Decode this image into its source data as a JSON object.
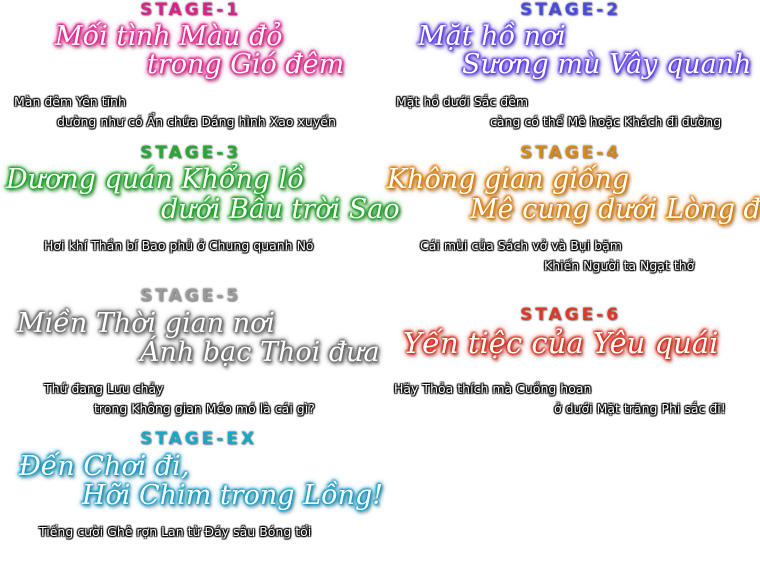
{
  "stages": [
    {
      "tag": "STAGE-1",
      "title_lines": [
        "Mối tình Màu đỏ",
        "trong Gió đêm"
      ],
      "desc_lines": [
        "Màn đêm Yên tĩnh",
        "dường như có Ẩn chứa Dáng hình Xao xuyến"
      ],
      "tag_color": "#e0208a",
      "glow_color": "#e0208a"
    },
    {
      "tag": "STAGE-2",
      "title_lines": [
        "Mặt hồ nơi",
        "Sương mù Vây quanh"
      ],
      "desc_lines": [
        "Mặt hồ dưới Sắc đêm",
        "càng có thể Mê hoặc Khách đi đường"
      ],
      "tag_color": "#4a4ae0",
      "glow_color": "#5a3ae8"
    },
    {
      "tag": "STAGE-3",
      "title_lines": [
        "Dương quán Khổng lồ",
        "dưới Bầu trời Sao"
      ],
      "desc_lines": [
        "Hơi khí Thần bí Bao phủ ở Chung quanh Nó"
      ],
      "tag_color": "#22aa33",
      "glow_color": "#18a020"
    },
    {
      "tag": "STAGE-4",
      "title_lines": [
        "Không gian giống",
        "Mê cung dưới Lòng đất"
      ],
      "desc_lines": [
        "Cái mùi của Sách vở và Bụi bặm",
        "Khiến Người ta Ngạt thở"
      ],
      "tag_color": "#d88a10",
      "glow_color": "#d87a08"
    },
    {
      "tag": "STAGE-5",
      "title_lines": [
        "Miền Thời gian nơi",
        "Ánh bạc Thoi đưa"
      ],
      "desc_lines": [
        "Thứ đang Lưu chảy",
        "trong Không gian Méo mó là cái gì?"
      ],
      "tag_color": "#9a9a9a",
      "glow_color": "#6a6a6a"
    },
    {
      "tag": "STAGE-6",
      "title_lines": [
        "Yến tiệc của Yêu quái"
      ],
      "desc_lines": [
        "Hãy Thỏa thích mà Cuồng hoan",
        "ở dưới Mặt trăng Phi sắc đi!"
      ],
      "tag_color": "#e03828",
      "glow_color": "#d82818"
    },
    {
      "tag": "STAGE-EX",
      "title_lines": [
        "Đến Chơi đi,",
        "Hỡi Chim trong Lồng!"
      ],
      "desc_lines": [
        "Tiếng cười Ghê rợn Lan từ Đáy sâu Bóng tối"
      ],
      "tag_color": "#18a8c8",
      "glow_color": "#1898c0"
    }
  ]
}
